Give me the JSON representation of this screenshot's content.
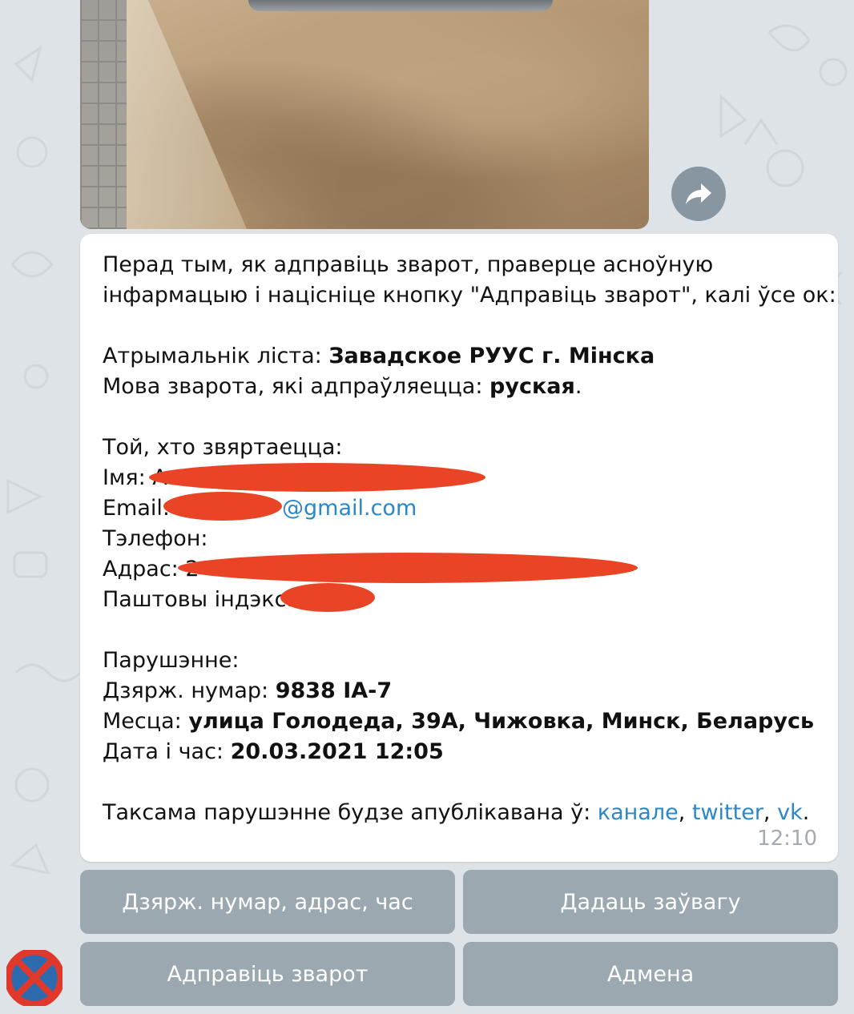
{
  "message": {
    "intro": "Перад тым, як адправіць зварот, праверце асноўную",
    "intro2": "інфармацыю і націсніце кнопку \"Адправіць зварот\", калі ўсе ок:",
    "recipient_label": "Атрымальнік ліста: ",
    "recipient_value": "Завадское РУУС г. Мінска",
    "language_label": "Мова зварота, які адпраўляецца: ",
    "language_value": "руская",
    "language_suffix": ".",
    "applicant_header": "Той, хто звяртаецца:",
    "name_label": "Імя: ",
    "name_value_visible": "А",
    "email_label": "Email:",
    "email_visible": "@gmail.com",
    "phone_label": "Тэлефон:",
    "address_label": "Адрас: ",
    "address_visible": "2",
    "postcode_label": "Паштовы індэкс:",
    "violation_header": "Парушэнне:",
    "plate_label": "Дзярж. нумар: ",
    "plate_value": "9838 IA-7",
    "place_label": "Месца: ",
    "place_value": "улица Голодеда, 39А, Чижовка, Минск, Беларусь",
    "datetime_label": "Дата і час: ",
    "datetime_value": "20.03.2021 12:05",
    "publish_text": "Таксама парушэнне будзе апублікавана ў: ",
    "publish_links": [
      "канале",
      "twitter",
      "vk"
    ],
    "sep": ", ",
    "end": ".",
    "time": "12:10"
  },
  "keyboard": {
    "btn1": "Дзярж. нумар, адрас, час",
    "btn2": "Дадаць заўвагу",
    "btn3": "Адправіць зварот",
    "btn4": "Адмена"
  },
  "colors": {
    "background": "#dde3e7",
    "link": "#2a87c8",
    "redaction": "#e94426",
    "keyboard_button": "#8a97a0"
  },
  "icons": {
    "share": "share-arrow-icon",
    "avatar": "no-stopping-sign-icon"
  }
}
